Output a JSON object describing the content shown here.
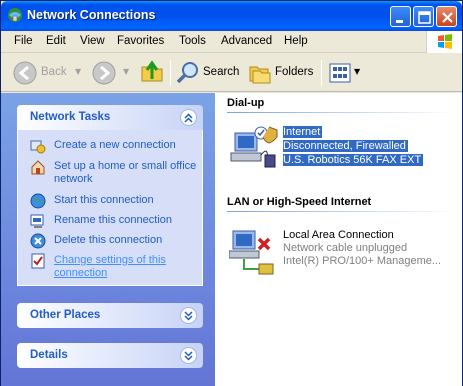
{
  "window": {
    "title": "Network Connections"
  },
  "menu": [
    "File",
    "Edit",
    "View",
    "Favorites",
    "Tools",
    "Advanced",
    "Help"
  ],
  "toolbar": {
    "back_label": "Back",
    "search_label": "Search",
    "folders_label": "Folders"
  },
  "left_panels": {
    "network_tasks": {
      "title": "Network Tasks",
      "items": [
        {
          "label": "Create a new connection",
          "icon": "new-connection-icon"
        },
        {
          "label": "Set up a home or small office network",
          "icon": "home-network-icon"
        },
        {
          "label": "Start this connection",
          "icon": "globe-icon"
        },
        {
          "label": "Rename this connection",
          "icon": "rename-icon"
        },
        {
          "label": "Delete this connection",
          "icon": "delete-icon"
        },
        {
          "label": "Change settings of this connection",
          "icon": "settings-icon"
        }
      ]
    },
    "other_places": {
      "title": "Other Places"
    },
    "details": {
      "title": "Details"
    }
  },
  "groups": [
    {
      "title": "Dial-up",
      "connections": [
        {
          "name": "Internet",
          "status": "Disconnected, Firewalled",
          "device": "U.S. Robotics 56K FAX EXT",
          "selected": true
        }
      ]
    },
    {
      "title": "LAN or High-Speed Internet",
      "connections": [
        {
          "name": "Local Area Connection",
          "status": "Network cable unplugged",
          "device": "Intel(R) PRO/100+ Manageme...",
          "selected": false
        }
      ]
    }
  ],
  "colors": {
    "titlebar": "#0053ee",
    "task_link": "#215dc6",
    "selection": "#316ac5",
    "left_pane_top": "#7ba2e7",
    "left_pane_bottom": "#6375d6"
  }
}
